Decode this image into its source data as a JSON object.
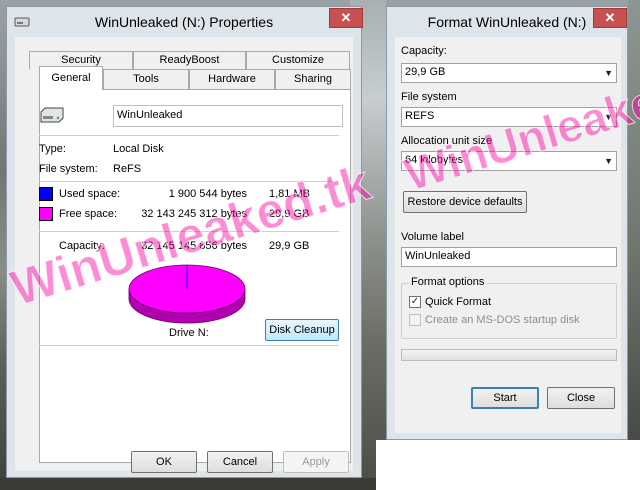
{
  "properties": {
    "title": "WinUnleaked (N:) Properties",
    "close_symbol": "✕",
    "tabs": [
      {
        "label": "Security"
      },
      {
        "label": "ReadyBoost"
      },
      {
        "label": "Customize"
      },
      {
        "label": "General"
      },
      {
        "label": "Tools"
      },
      {
        "label": "Hardware"
      },
      {
        "label": "Sharing"
      }
    ],
    "active_tab": "General",
    "drive_name": "WinUnleaked",
    "type_label": "Type:",
    "type_value": "Local Disk",
    "fs_label": "File system:",
    "fs_value": "ReFS",
    "used": {
      "label": "Used space:",
      "bytes": "1 900 544 bytes",
      "size": "1,81 MB",
      "color": "#0000ff"
    },
    "free": {
      "label": "Free space:",
      "bytes": "32 143 245 312 bytes",
      "size": "29,9 GB",
      "color": "#ff00ff"
    },
    "capacity": {
      "label": "Capacity:",
      "bytes": "32 145 145 856 bytes",
      "size": "29,9 GB"
    },
    "drive_label": "Drive N:",
    "used_fraction": 5.91e-05,
    "disk_cleanup": "Disk Cleanup",
    "buttons": {
      "ok": "OK",
      "cancel": "Cancel",
      "apply": "Apply"
    }
  },
  "format": {
    "title": "Format WinUnleaked (N:)",
    "close_symbol": "✕",
    "capacity_label": "Capacity:",
    "capacity_value": "29,9 GB",
    "fs_label": "File system",
    "fs_value": "REFS",
    "alloc_label": "Allocation unit size",
    "alloc_value": "64 kilobytes",
    "restore_button": "Restore device defaults",
    "volume_label_caption": "Volume label",
    "volume_label_value": "WinUnleaked",
    "format_options_caption": "Format options",
    "quick_format_label": "Quick Format",
    "quick_format_checked": true,
    "msdos_label": "Create an MS-DOS startup disk",
    "msdos_checked": false,
    "progress": 0,
    "start_button": "Start",
    "close_button": "Close"
  },
  "watermark": "WinUnleaked.tk",
  "colors": {
    "close": "#c75050",
    "used": "#0000ff",
    "free": "#ff00ff",
    "watermark": "#f800a0"
  },
  "icons": {
    "drive": "drive-icon",
    "close": "close-icon",
    "dropdown": "chevron-down-icon"
  }
}
